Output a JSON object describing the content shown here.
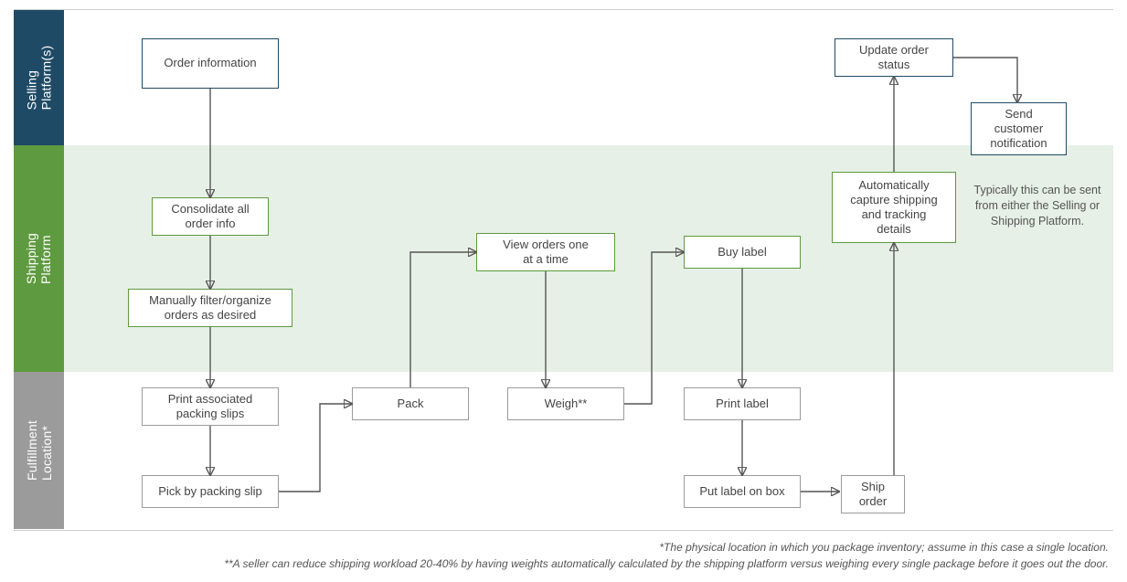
{
  "lanes": {
    "selling": "Selling\nPlatform(s)",
    "shipping": "Shipping\nPlatform",
    "fulfillment": "Fulfillment\nLocation*"
  },
  "nodes": {
    "order_information": "Order information",
    "consolidate": "Consolidate all\norder info",
    "filter": "Manually filter/organize\norders as desired",
    "print_slips": "Print associated\npacking slips",
    "pick": "Pick by packing slip",
    "pack": "Pack",
    "view_orders": "View orders one\nat a time",
    "weigh": "Weigh**",
    "buy_label": "Buy label",
    "print_label": "Print label",
    "put_label": "Put label on box",
    "ship_order": "Ship\norder",
    "capture_details": "Automatically\ncapture shipping\nand tracking\ndetails",
    "update_status": "Update order\nstatus",
    "send_notification": "Send\ncustomer\nnotification"
  },
  "annotation": "Typically this can be sent\nfrom either the Selling or\nShipping Platform.",
  "footnotes": {
    "f1": "*The physical location in which you package inventory; assume in this case a single location.",
    "f2": "**A seller can reduce shipping workload 20-40% by having weights automatically calculated by the shipping platform versus weighing every single package before it goes out the door."
  }
}
